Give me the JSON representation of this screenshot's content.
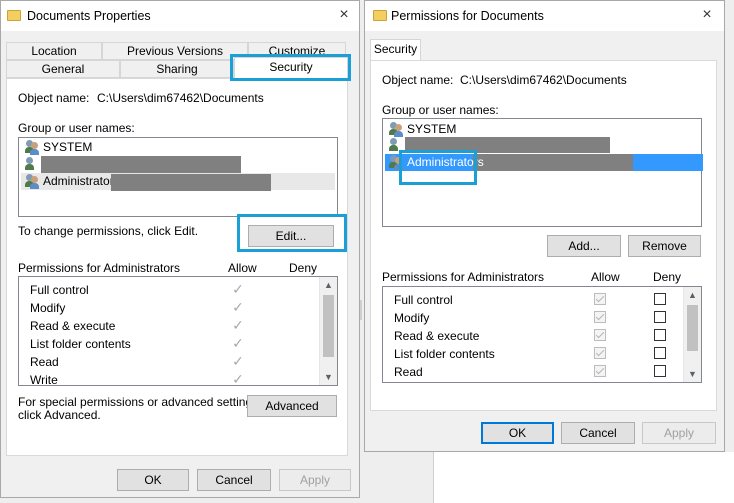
{
  "left_window": {
    "title": "Documents Properties",
    "tabs_row1": [
      "Location",
      "Previous Versions",
      "Customize"
    ],
    "tabs_row2": [
      "General",
      "Sharing",
      "Security"
    ],
    "object_name_label": "Object name:",
    "object_name_value": "C:\\Users\\dim67462\\Documents",
    "group_label": "Group or user names:",
    "users": [
      "SYSTEM",
      "",
      "Administrators"
    ],
    "change_text": "To change permissions, click Edit.",
    "edit_button": "Edit...",
    "permissions_label": "Permissions for Administrators",
    "allow_header": "Allow",
    "deny_header": "Deny",
    "permissions": [
      "Full control",
      "Modify",
      "Read & execute",
      "List folder contents",
      "Read",
      "Write"
    ],
    "special_text_line1": "For special permissions or advanced settings,",
    "special_text_line2": "click Advanced.",
    "advanced_button": "Advanced",
    "ok_button": "OK",
    "cancel_button": "Cancel",
    "apply_button": "Apply"
  },
  "right_window": {
    "title": "Permissions for Documents",
    "tab": "Security",
    "object_name_label": "Object name:",
    "object_name_value": "C:\\Users\\dim67462\\Documents",
    "group_label": "Group or user names:",
    "users": [
      "SYSTEM",
      "",
      "Administrators"
    ],
    "add_button": "Add...",
    "remove_button": "Remove",
    "permissions_label": "Permissions for Administrators",
    "allow_header": "Allow",
    "deny_header": "Deny",
    "permissions": [
      "Full control",
      "Modify",
      "Read & execute",
      "List folder contents",
      "Read"
    ],
    "ok_button": "OK",
    "cancel_button": "Cancel",
    "apply_button": "Apply"
  },
  "icons": {
    "close": "×",
    "check": "✓",
    "scroll_up": "▲",
    "scroll_down": "▼"
  },
  "colors": {
    "highlight": "#1a9fd6",
    "selection": "#3399ff",
    "default_button_border": "#0078d7"
  }
}
